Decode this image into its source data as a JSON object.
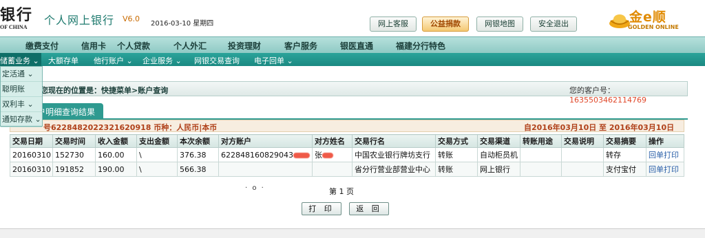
{
  "header": {
    "logo": "银行",
    "logo_sub": "OF CHINA",
    "title": "个人网上银行",
    "version": "V6.0",
    "date": "2016-03-10 星期四",
    "buttons": [
      "网上客服",
      "公益捐款",
      "网银地图",
      "安全退出"
    ],
    "brand_cn": "金e顺",
    "brand_en": "GOLDEN ONLINE",
    "accent_color": "#e08a00",
    "theme_color": "#1b8a82"
  },
  "nav1": [
    "缴费支付",
    "信用卡",
    "个人贷款",
    "个人外汇",
    "投资理财",
    "客户服务",
    "银医直通",
    "福建分行特色"
  ],
  "nav2": {
    "active": "储蓄业务",
    "items": [
      "大额存单",
      "他行账户",
      "企业服务",
      "网银交易查询",
      "电子回单"
    ]
  },
  "dropdown": [
    "定活通",
    "聪明账",
    "双利丰",
    "通知存款"
  ],
  "location": {
    "text": "您现在的位置是：快捷菜单>账户查询",
    "customer_label": "您的客户号：",
    "customer_no": "1635503462114769"
  },
  "tab": {
    "label": "户明细查询结果"
  },
  "info": {
    "account": "号6228482022321620918 币种：人民币|本币",
    "range": "自2016年03月10日  至  2016年03月10日"
  },
  "table": {
    "headers": [
      "交易日期",
      "交易时间",
      "收入金额",
      "支出金额",
      "本次余额",
      "对方账户",
      "对方姓名",
      "交易行名",
      "交易方式",
      "交易渠道",
      "转账用途",
      "交易说明",
      "交易摘要",
      "操作"
    ],
    "rows": [
      [
        "20160310",
        "152730",
        "160.00",
        "\\",
        "376.38",
        "622848160829043",
        "张",
        "中国农业银行牌坊支行",
        "转账",
        "自动柜员机",
        "",
        "",
        "转存",
        "回单打印"
      ],
      [
        "20160310",
        "191852",
        "190.00",
        "\\",
        "566.38",
        "",
        "",
        "省分行营业部营业中心",
        "转账",
        "网上银行",
        "",
        "",
        "支付宝付",
        "回单打印"
      ]
    ]
  },
  "pager": "第 1 页",
  "dot_mark": "· o ·",
  "actions": {
    "print": "打 印",
    "back": "返 回"
  }
}
